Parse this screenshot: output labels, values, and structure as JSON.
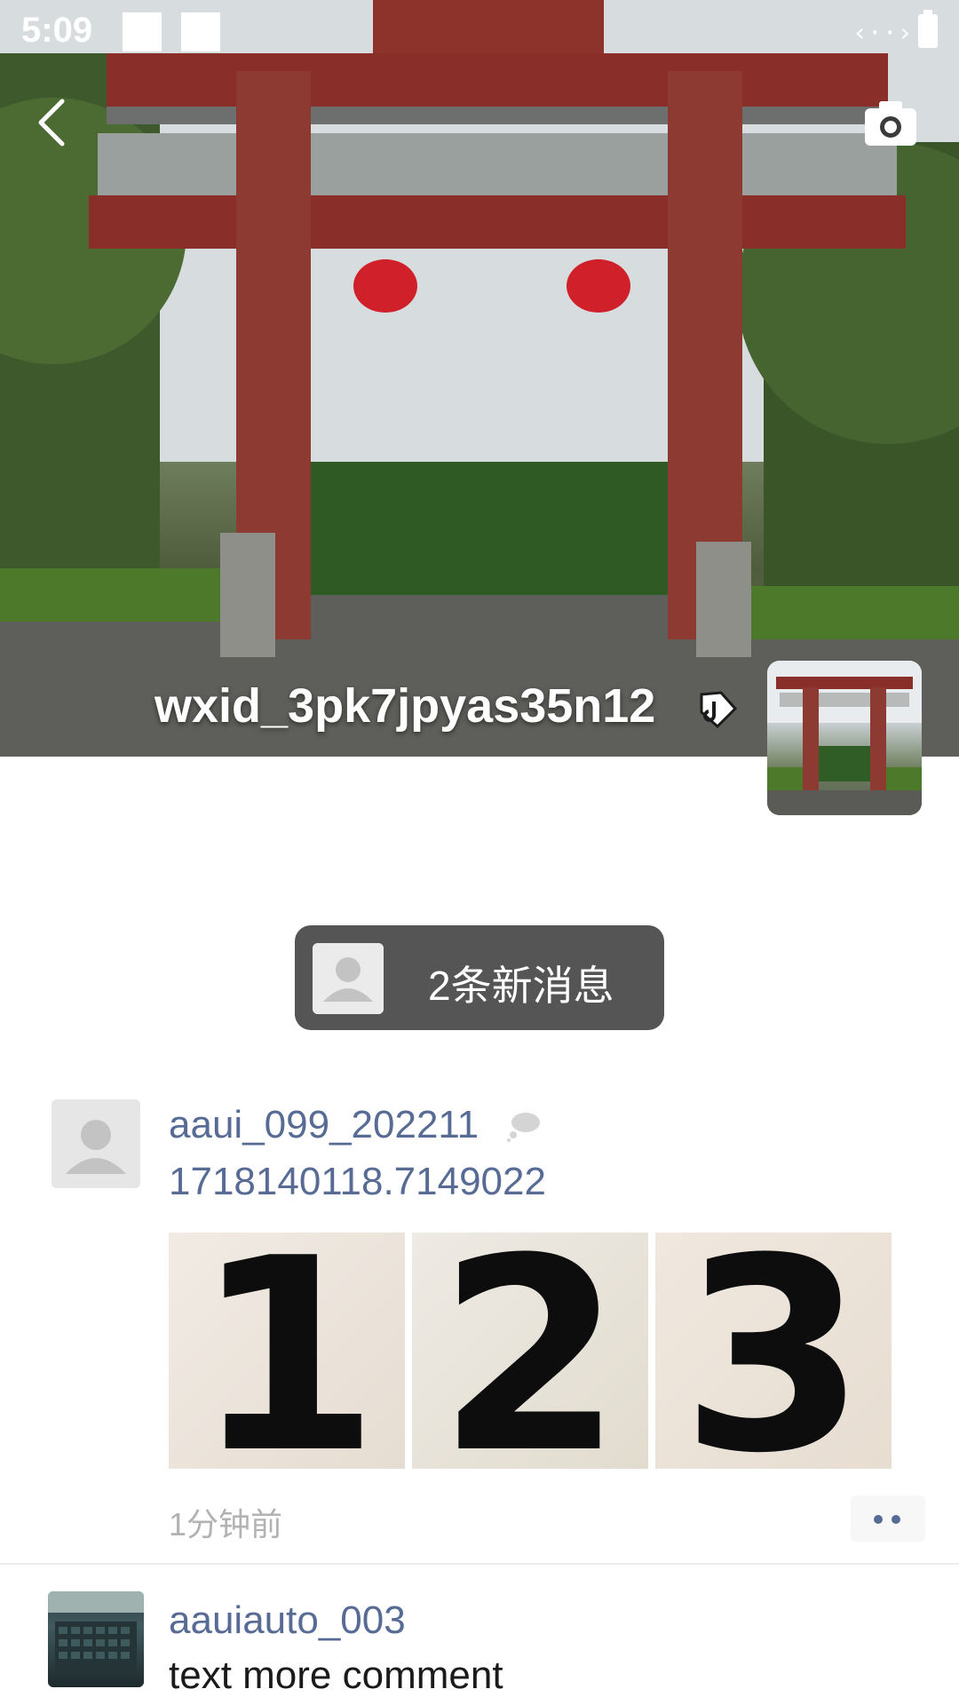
{
  "status_bar": {
    "time": "5:09"
  },
  "cover": {
    "username": "wxid_3pk7jpyas35n12"
  },
  "new_messages": {
    "label": "2条新消息"
  },
  "post": {
    "author": "aaui_099_202211",
    "text": "1718140118.7149022",
    "images": [
      "1",
      "2",
      "3"
    ],
    "time": "1分钟前"
  },
  "next_post": {
    "author": "aauiauto_003",
    "text": "text more comment"
  },
  "icons": {
    "back": "back-arrow-icon",
    "camera": "camera-icon",
    "tag": "tag-icon",
    "comment": "comment-bubble-icon",
    "more": "more-dots-icon",
    "avatar_placeholder": "person-icon"
  },
  "colors": {
    "link": "#576b95",
    "time": "#b2b2b2",
    "pill": "#555555"
  }
}
